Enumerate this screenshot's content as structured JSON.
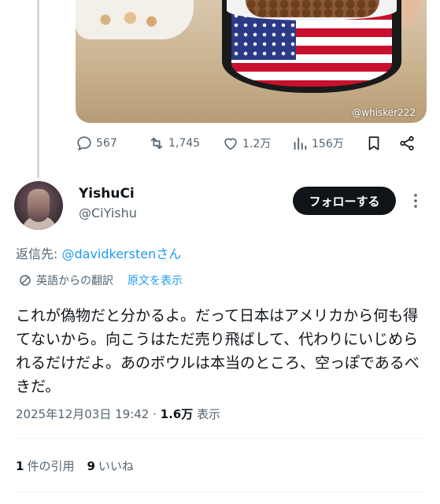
{
  "media": {
    "watermark": "@whisker222"
  },
  "actions": {
    "replies": "567",
    "reposts": "1,745",
    "likes": "1.2万",
    "views": "156万"
  },
  "post": {
    "display_name": "YishuCi",
    "handle": "@CiYishu",
    "follow_label": "フォローする",
    "reply_prefix": "返信先: ",
    "reply_to": "@davidkersten",
    "reply_suffix": "さん",
    "translated_from": "英語からの翻訳",
    "show_original": "原文を表示",
    "text": "これが偽物だと分かるよ。だって日本はアメリカから何も得てないから。向こうはただ売り飛ばして、代わりにいじめられるだけだよ。あのボウルは本当のところ、空っぽであるべきだ。",
    "timestamp": "2025年12月03日 19:42 · ",
    "view_count": "1.6万",
    "view_suffix": " 表示"
  },
  "stats": {
    "quotes_count": "1",
    "quotes_label": "件の引用",
    "likes_count": "9",
    "likes_label": "いいね"
  },
  "colors": {
    "accent": "#1d9bf0",
    "text_primary": "#0f1419",
    "text_secondary": "#536471",
    "button_bg": "#0f1419"
  }
}
